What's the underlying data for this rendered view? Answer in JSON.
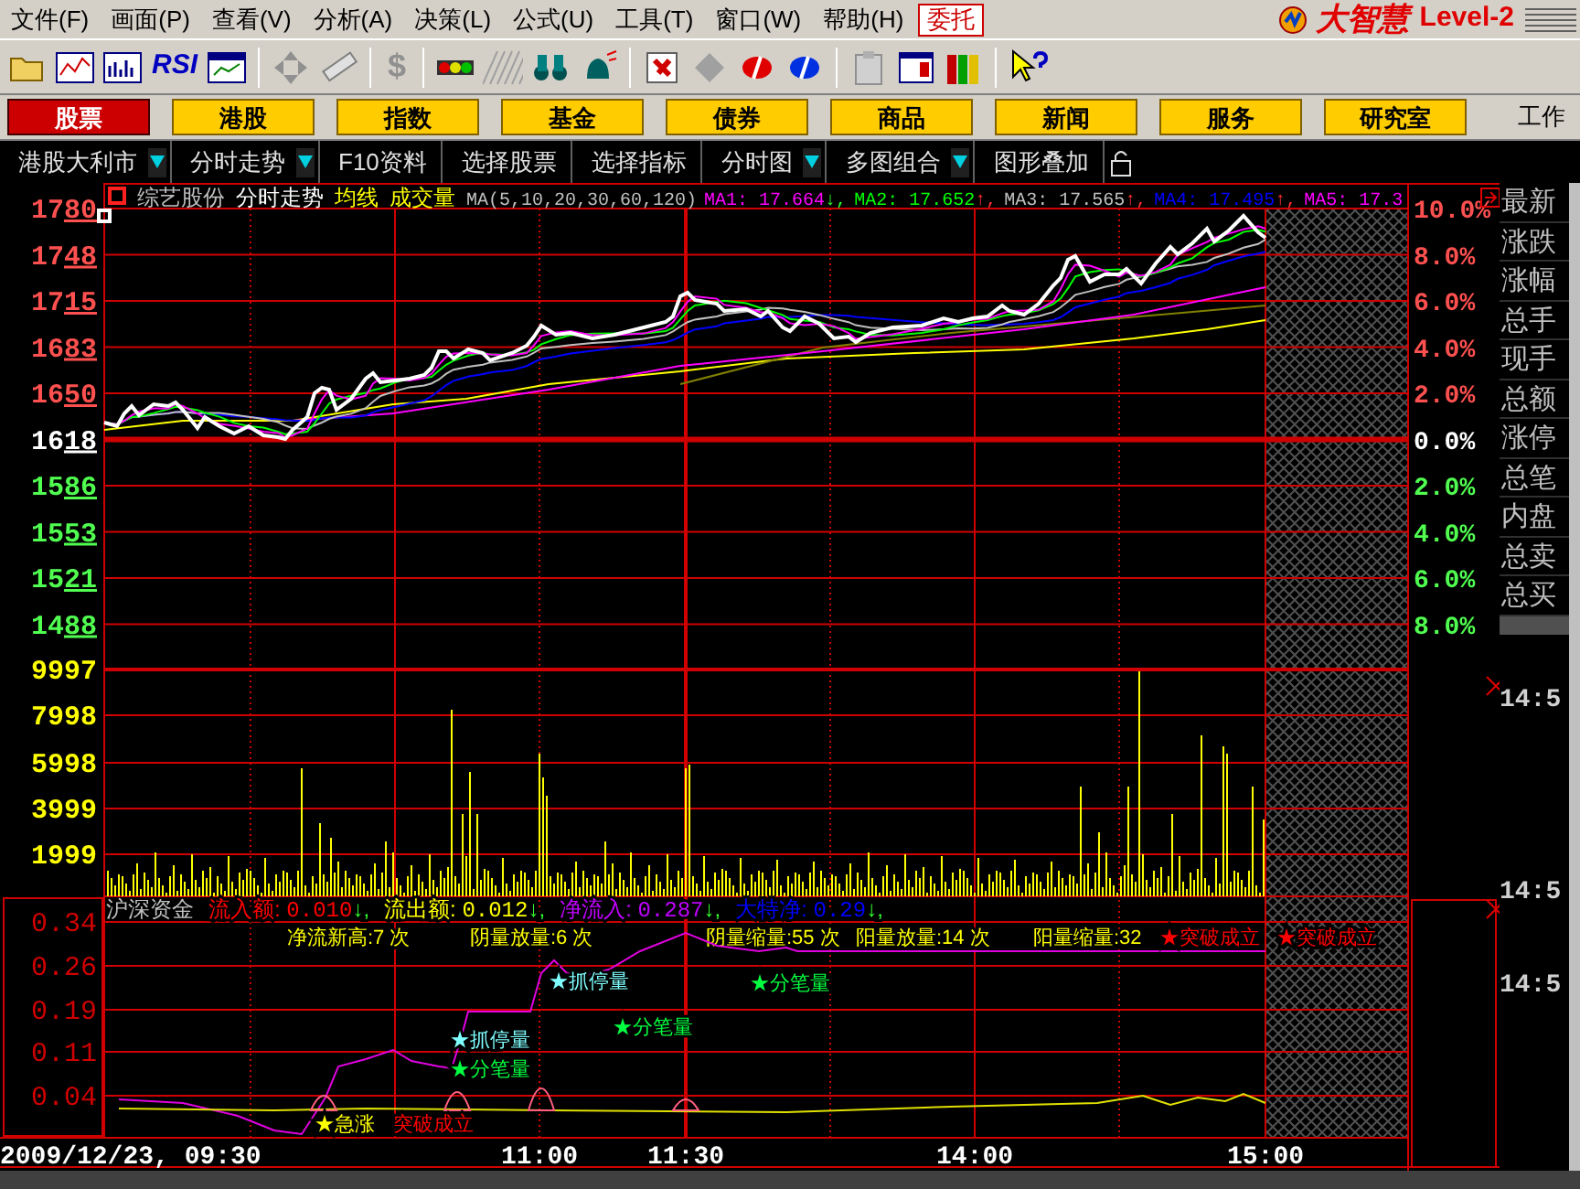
{
  "menu": [
    "文件(F)",
    "画面(P)",
    "查看(V)",
    "分析(A)",
    "决策(L)",
    "公式(U)",
    "工具(T)",
    "窗口(W)",
    "帮助(H)"
  ],
  "entrust_button": "委托",
  "logo": {
    "name": "大智慧",
    "edition": "Level-2"
  },
  "toolbar": {
    "rsi_text": "RSI",
    "dollar_text": "$"
  },
  "market_tabs": [
    {
      "label": "股票",
      "selected": true
    },
    {
      "label": "港股",
      "selected": false
    },
    {
      "label": "指数",
      "selected": false
    },
    {
      "label": "基金",
      "selected": false
    },
    {
      "label": "债券",
      "selected": false
    },
    {
      "label": "商品",
      "selected": false
    },
    {
      "label": "新闻",
      "selected": false
    },
    {
      "label": "服务",
      "selected": false
    },
    {
      "label": "研究室",
      "selected": false
    }
  ],
  "workspace_label": "工作",
  "sub_toolbar": [
    {
      "label": "港股大利市",
      "dropdown": true
    },
    {
      "label": "分时走势",
      "dropdown": true
    },
    {
      "label": "F10资料",
      "dropdown": false
    },
    {
      "label": "选择股票",
      "dropdown": false
    },
    {
      "label": "选择指标",
      "dropdown": false
    },
    {
      "label": "分时图",
      "dropdown": true
    },
    {
      "label": "多图组合",
      "dropdown": true
    },
    {
      "label": "图形叠加",
      "dropdown": false
    }
  ],
  "chart": {
    "header": [
      {
        "kind": "name",
        "text": "综艺股份"
      },
      {
        "kind": "view",
        "text": "分时走势"
      },
      {
        "kind": "toggle",
        "text": "均线"
      },
      {
        "kind": "toggle",
        "text": "成交量"
      },
      {
        "kind": "params",
        "text": "MA(5,10,20,30,60,120)"
      },
      {
        "kind": "ma",
        "text": "MA1: 17.664",
        "arrow": "↓,",
        "rising": false,
        "color": "#ff00ff"
      },
      {
        "kind": "ma",
        "text": "MA2: 17.652",
        "arrow": "↑,",
        "rising": true,
        "color": "#00ff00"
      },
      {
        "kind": "ma",
        "text": "MA3: 17.565",
        "arrow": "↑,",
        "rising": true,
        "color": "#c0c0c0"
      },
      {
        "kind": "ma",
        "text": "MA4: 17.495",
        "arrow": "↑,",
        "rising": true,
        "color": "#0000ff"
      },
      {
        "kind": "ma",
        "text": "MA5: 17.3",
        "color": "#ff00ff"
      }
    ],
    "price_axis": [
      {
        "label": "1780",
        "kind": "up"
      },
      {
        "label": "1748",
        "kind": "up"
      },
      {
        "label": "1715",
        "kind": "up"
      },
      {
        "label": "1683",
        "kind": "up"
      },
      {
        "label": "1650",
        "kind": "up"
      },
      {
        "label": "1618",
        "kind": "flat"
      },
      {
        "label": "1586",
        "kind": "down"
      },
      {
        "label": "1553",
        "kind": "down"
      },
      {
        "label": "1521",
        "kind": "down"
      },
      {
        "label": "1488",
        "kind": "down"
      }
    ],
    "percent_axis": [
      {
        "label": "10.0%",
        "kind": "up"
      },
      {
        "label": "8.0%",
        "kind": "up"
      },
      {
        "label": "6.0%",
        "kind": "up"
      },
      {
        "label": "4.0%",
        "kind": "up"
      },
      {
        "label": "2.0%",
        "kind": "up"
      },
      {
        "label": "0.0%",
        "kind": "flat"
      },
      {
        "label": "2.0%",
        "kind": "down"
      },
      {
        "label": "4.0%",
        "kind": "down"
      },
      {
        "label": "6.0%",
        "kind": "down"
      },
      {
        "label": "8.0%",
        "kind": "down"
      }
    ],
    "volume_axis": [
      "9997",
      "7998",
      "5998",
      "3999",
      "1999"
    ],
    "time_axis": [
      "2009/12/23, 09:30",
      "11:00",
      "11:30",
      "14:00",
      "15:00"
    ]
  },
  "fund_panel": {
    "title": "沪深资金",
    "readings": [
      {
        "label": "流入额:",
        "value": "0.010",
        "arrow": "↓,",
        "color": "#ff0000"
      },
      {
        "label": "流出额:",
        "value": "0.012",
        "arrow": "↓,",
        "color": "#ffff00"
      },
      {
        "label": "净流入:",
        "value": "0.287",
        "arrow": "↓,",
        "color": "#c000ff"
      },
      {
        "label": "大特净:",
        "value": "0.29",
        "arrow": "↓,",
        "color": "#0000ff"
      }
    ],
    "axis": [
      "0.34",
      "0.26",
      "0.19",
      "0.11",
      "0.04"
    ],
    "counters": [
      "净流新高:7 次",
      "阴量放量:6 次",
      "阴量缩量:55 次",
      "阳量放量:14 次",
      "阳量缩量:32"
    ],
    "signals": [
      {
        "kind": "limit",
        "text": "★抓停量"
      },
      {
        "kind": "tick",
        "text": "★分笔量"
      },
      {
        "kind": "limit",
        "text": "★抓停量"
      },
      {
        "kind": "tick",
        "text": "★分笔量"
      },
      {
        "kind": "tick",
        "text": "★分笔量"
      },
      {
        "kind": "breakout",
        "text": "★突破成立"
      },
      {
        "kind": "breakout",
        "text": "★突破成立"
      },
      {
        "kind": "surge",
        "text": "★急涨"
      },
      {
        "kind": "breakout",
        "text": "突破成立"
      }
    ]
  },
  "quote_panel": {
    "labels": [
      "最新",
      "涨跌",
      "涨幅",
      "总手",
      "现手",
      "总额",
      "涨停",
      "总笔",
      "内盘",
      "总卖",
      "总买"
    ],
    "times": [
      "14:5",
      "14:5",
      "14:5"
    ]
  }
}
